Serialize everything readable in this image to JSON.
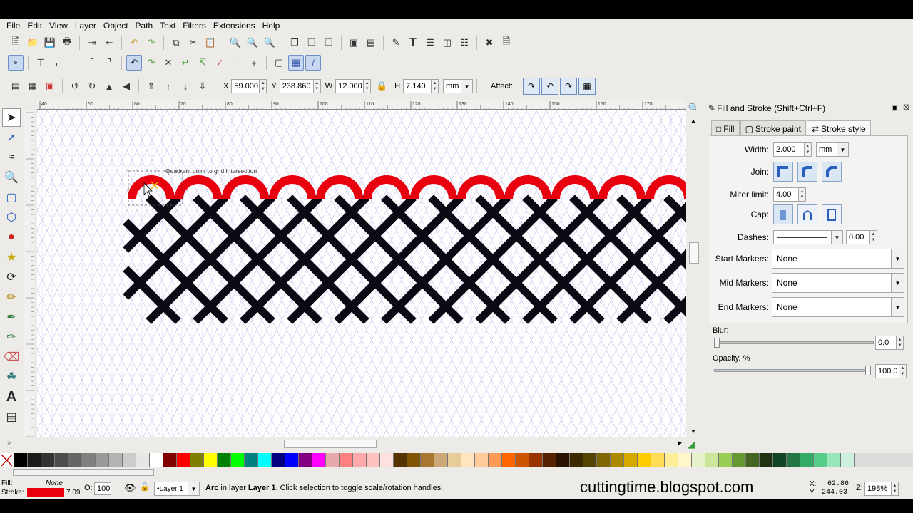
{
  "menu": [
    "File",
    "Edit",
    "View",
    "Layer",
    "Object",
    "Path",
    "Text",
    "Filters",
    "Extensions",
    "Help"
  ],
  "toolbar": {
    "x_label": "X",
    "x_value": "59.000",
    "y_label": "Y",
    "y_value": "238.860",
    "w_label": "W",
    "w_value": "12.000",
    "h_label": "H",
    "h_value": "7.140",
    "unit": "mm",
    "affect_label": "Affect:"
  },
  "ruler_top_ticks": [
    "40",
    "50",
    "60",
    "70",
    "80",
    "90",
    "100",
    "110",
    "120",
    "130",
    "140",
    "150",
    "160",
    "170",
    "180"
  ],
  "canvas": {
    "snap_tooltip": "Quadrant point to grid intersection",
    "arc_color": "#e8000f",
    "mesh_color": "#0a0a14"
  },
  "panel": {
    "title": "Fill and Stroke (Shift+Ctrl+F)",
    "tabs": [
      "Fill",
      "Stroke paint",
      "Stroke style"
    ],
    "width_label": "Width:",
    "width_value": "2.000",
    "width_unit": "mm",
    "join_label": "Join:",
    "miter_label": "Miter limit:",
    "miter_value": "4.00",
    "cap_label": "Cap:",
    "dashes_label": "Dashes:",
    "dashes_value": "0.00",
    "start_markers_label": "Start Markers:",
    "start_markers_value": "None",
    "mid_markers_label": "Mid Markers:",
    "mid_markers_value": "None",
    "end_markers_label": "End Markers:",
    "end_markers_value": "None",
    "blur_label": "Blur:",
    "blur_value": "0.0",
    "opacity_label": "Opacity, %",
    "opacity_value": "100.0"
  },
  "palette": [
    "#000000",
    "#1a1a1a",
    "#333333",
    "#4d4d4d",
    "#666666",
    "#808080",
    "#999999",
    "#b3b3b3",
    "#cccccc",
    "#e6e6e6",
    "#ffffff",
    "#800000",
    "#ff0000",
    "#808000",
    "#ffff00",
    "#008000",
    "#00ff00",
    "#008080",
    "#00ffff",
    "#000080",
    "#0000ff",
    "#800080",
    "#ff00ff",
    "#e6a8a8",
    "#ff8080",
    "#ffaaaa",
    "#ffc0c0",
    "#ffe0e0",
    "#553300",
    "#805500",
    "#aa7733",
    "#ccaa77",
    "#e6cc99",
    "#ffe6bf",
    "#ffcc99",
    "#ff9955",
    "#ff6600",
    "#cc5500",
    "#993300",
    "#552200",
    "#2b1100",
    "#3d2b00",
    "#554400",
    "#806600",
    "#aa8800",
    "#d4aa00",
    "#ffcc00",
    "#ffdd55",
    "#ffee99",
    "#fff6cc",
    "#e6f2cc",
    "#cce699",
    "#99cc55",
    "#669933",
    "#446622",
    "#223311",
    "#114422",
    "#227744",
    "#33aa66",
    "#55cc88",
    "#99e6bb",
    "#ccf2dd"
  ],
  "status": {
    "fill_label": "Fill:",
    "fill_value": "None",
    "stroke_label": "Stroke:",
    "stroke_width": "7.09",
    "stroke_color": "#e8000f",
    "opacity_label": "O:",
    "opacity_value": "100",
    "layer": "•Layer 1",
    "message_obj": "Arc",
    "message_mid": " in layer ",
    "message_layer": "Layer 1",
    "message_tail": ". Click selection to toggle scale/rotation handles.",
    "x_coord_label": "X:",
    "x_coord": "62.86",
    "y_coord_label": "Y:",
    "y_coord": "244.03",
    "zoom_label": "Z:",
    "zoom_value": "198%"
  },
  "watermark": "cuttingtime.blogspot.com"
}
